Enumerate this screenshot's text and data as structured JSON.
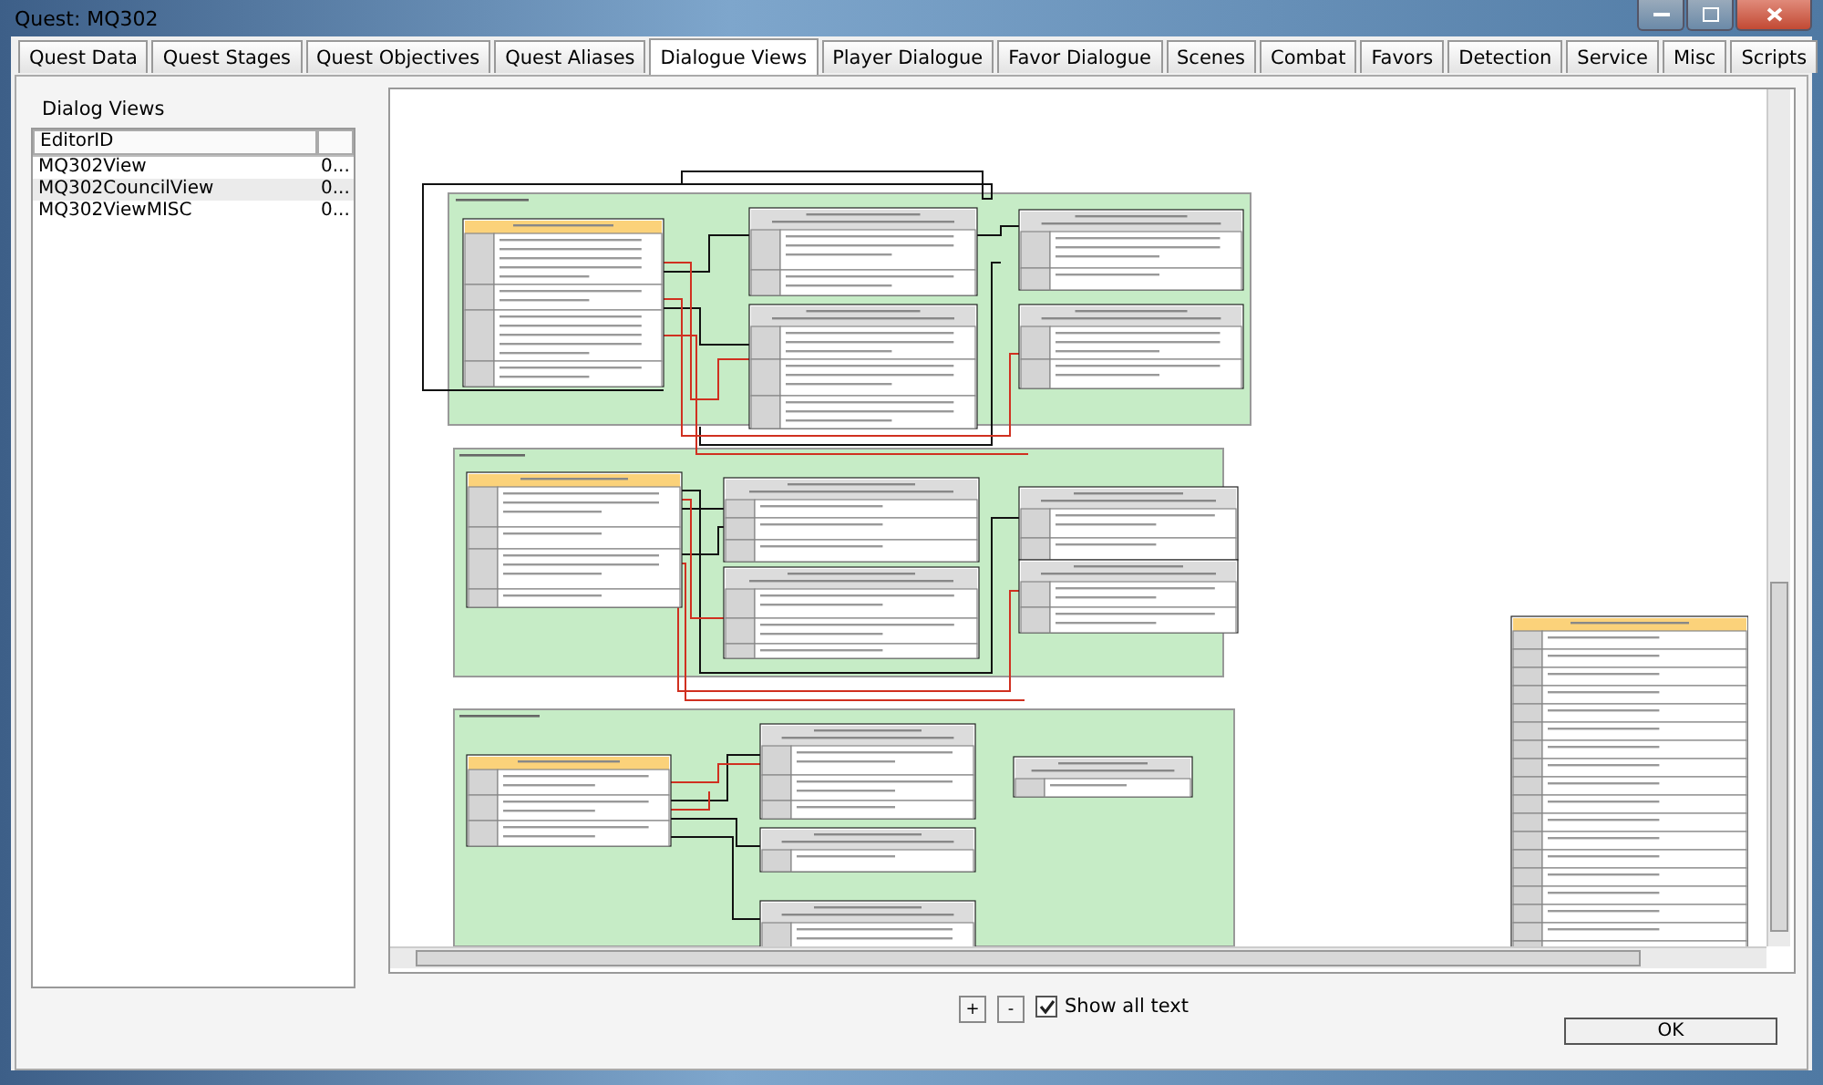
{
  "window": {
    "title": "Quest: MQ302"
  },
  "tabs": [
    {
      "label": "Quest Data",
      "selected": false
    },
    {
      "label": "Quest Stages",
      "selected": false
    },
    {
      "label": "Quest Objectives",
      "selected": false
    },
    {
      "label": "Quest Aliases",
      "selected": false
    },
    {
      "label": "Dialogue Views",
      "selected": true
    },
    {
      "label": "Player Dialogue",
      "selected": false
    },
    {
      "label": "Favor Dialogue",
      "selected": false
    },
    {
      "label": "Scenes",
      "selected": false
    },
    {
      "label": "Combat",
      "selected": false
    },
    {
      "label": "Favors",
      "selected": false
    },
    {
      "label": "Detection",
      "selected": false
    },
    {
      "label": "Service",
      "selected": false
    },
    {
      "label": "Misc",
      "selected": false
    },
    {
      "label": "Scripts",
      "selected": false
    }
  ],
  "dialog_views": {
    "title": "Dialog Views",
    "columns": [
      "EditorID"
    ],
    "rows": [
      {
        "editor_id": "MQ302View",
        "column_2": "0...",
        "selected": false
      },
      {
        "editor_id": "MQ302CouncilView",
        "column_2": "0...",
        "selected": true
      },
      {
        "editor_id": "MQ302ViewMISC",
        "column_2": "0...",
        "selected": false
      }
    ]
  },
  "zoom_buttons": [
    "+",
    "-"
  ],
  "show_all_text": {
    "label": "Show all text",
    "checked": true
  },
  "ok_button": "OK"
}
